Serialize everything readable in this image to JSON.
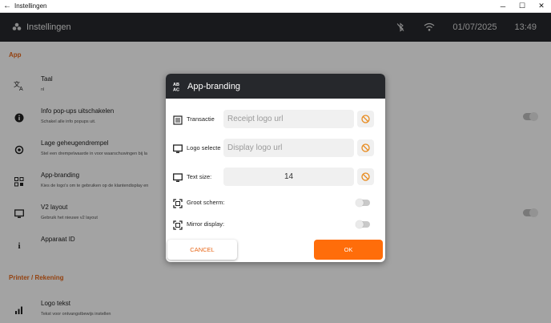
{
  "window": {
    "title": "Instellingen",
    "back_icon": "back-arrow-icon",
    "min_glyph": "─",
    "max_glyph": "☐",
    "close_glyph": "✕"
  },
  "header": {
    "title": "Instellingen",
    "date": "01/07/2025",
    "time": "13:49",
    "icons": [
      "logo-icon",
      "bluetooth-off-icon",
      "wifi-icon"
    ]
  },
  "settings": {
    "section_app": "App",
    "section_printer": "Printer / Rekening",
    "items": [
      {
        "title": "Taal",
        "subtitle": "nl",
        "icon": "translate-icon"
      },
      {
        "title": "Info pop-ups uitschakelen",
        "subtitle": "Schakel alle info popups uit.",
        "icon": "info-icon"
      },
      {
        "title": "Lage geheugendrempel",
        "subtitle": "Stel een drempelwaarde in voor waarschuwingen bij la",
        "icon": "memory-icon"
      },
      {
        "title": "App-branding",
        "subtitle": "Kies de logo's om te gebruiken op de klantendisplay en",
        "icon": "branding-icon"
      },
      {
        "title": "V2 layout",
        "subtitle": "Gebruik het nieuwe v2 layout",
        "icon": "monitor-icon"
      },
      {
        "title": "Apparaat ID",
        "subtitle": "",
        "icon": "info-i-icon"
      },
      {
        "title": "Logo tekst",
        "subtitle": "Tekst voor ontvangstbewijs instellen",
        "icon": "chart-icon"
      }
    ]
  },
  "dialog": {
    "title": "App-branding",
    "title_icon": "branding-icon",
    "rows": [
      {
        "label": "Transactie",
        "placeholder": "Receipt logo url",
        "value": "",
        "icon": "receipt-icon"
      },
      {
        "label": "Logo selecte",
        "placeholder": "Display logo url",
        "value": "",
        "icon": "monitor-icon"
      },
      {
        "label": "Text size:",
        "placeholder": "",
        "value": "14",
        "icon": "monitor-icon"
      }
    ],
    "toggles": [
      {
        "label": "Groot scherm:",
        "icon": "fullscreen-icon",
        "on": false
      },
      {
        "label": "Mirror display:",
        "icon": "fullscreen-icon",
        "on": false
      }
    ],
    "cancel_label": "CANCEL",
    "ok_label": "OK",
    "accent": "#ff6d0a",
    "clear_icon": "clear-icon"
  }
}
